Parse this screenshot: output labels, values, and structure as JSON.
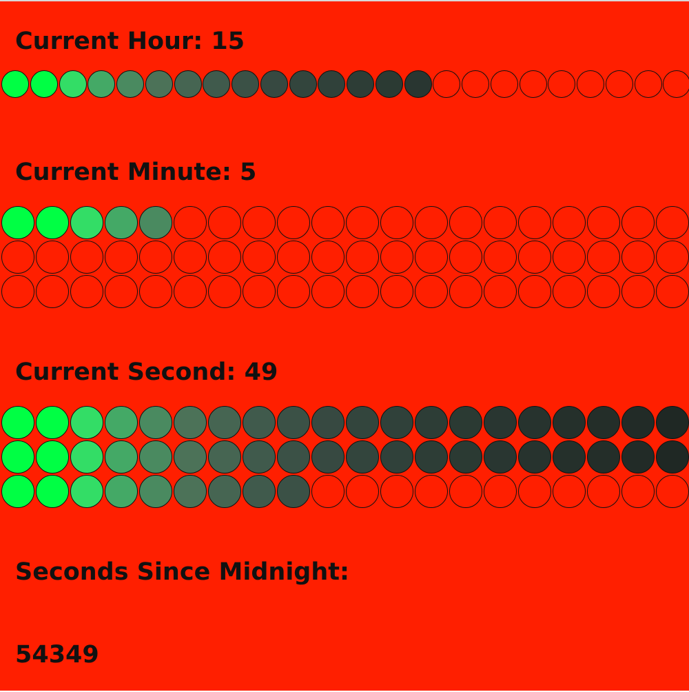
{
  "labels": {
    "hour": "Current Hour: 15",
    "minute": "Current Minute: 5",
    "second": "Current Second: 49",
    "seconds_since_midnight": "Seconds Since Midnight:",
    "seconds_value": "54349"
  },
  "clock": {
    "hour_lit": 15,
    "hour_total": 24,
    "minute_lit": 5,
    "minute_total": 60,
    "second_lit": 49,
    "second_total": 60
  },
  "colors": {
    "background": "#ff1f00",
    "off": "#ff1f00",
    "outline": "#111111",
    "gradient": [
      "#00ff44",
      "#00ff44",
      "#33dd66",
      "#44a966",
      "#4a8a60",
      "#4c7258",
      "#466552",
      "#405a4c",
      "#3b5146",
      "#374941",
      "#33453d",
      "#30413a",
      "#2d3d36",
      "#2b3a33",
      "#293631",
      "#27332e",
      "#25302b",
      "#242e29",
      "#222b27",
      "#1f2824"
    ]
  }
}
